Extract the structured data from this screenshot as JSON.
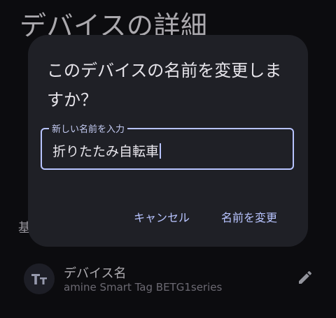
{
  "background": {
    "page_title": "デバイスの詳細",
    "section_fragment": "基",
    "device_item": {
      "title": "デバイス名",
      "subtitle": "amine Smart Tag BETG1series",
      "avatar_icon": "text-fields-icon",
      "edit_icon": "pencil-icon"
    }
  },
  "dialog": {
    "title": "このデバイスの名前を変更しますか？",
    "field": {
      "label": "新しい名前を入力",
      "value": "折りたたみ自転車"
    },
    "cancel_label": "キャンセル",
    "confirm_label": "名前を変更"
  },
  "colors": {
    "accent": "#b8c4ff",
    "dialog_surface": "#1f2026",
    "background": "#111114"
  }
}
